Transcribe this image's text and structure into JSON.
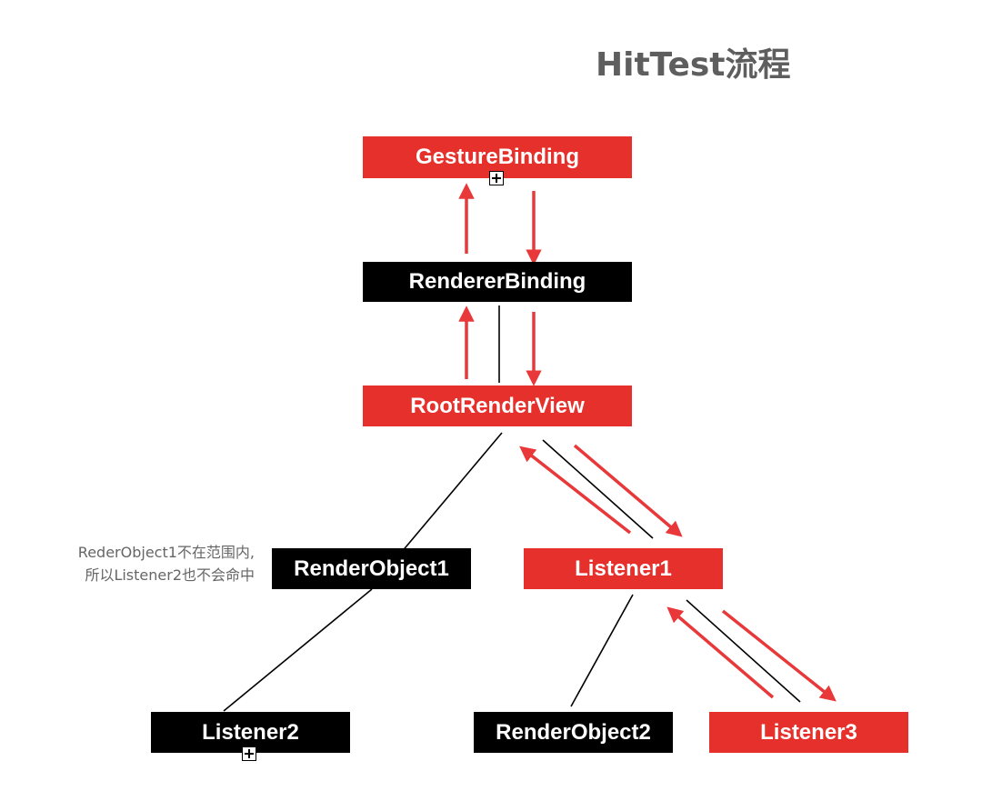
{
  "title": "HitTest流程",
  "nodes": {
    "gesture_binding": "GestureBinding",
    "renderer_binding": "RendererBinding",
    "root_render_view": "RootRenderView",
    "render_object1": "RenderObject1",
    "listener1": "Listener1",
    "listener2": "Listener2",
    "render_object2": "RenderObject2",
    "listener3": "Listener3"
  },
  "note": {
    "line1": "RederObject1不在范围内,",
    "line2": "所以Listener2也不会命中"
  },
  "icons": {
    "expand": "plus-square-icon"
  },
  "colors": {
    "hit": "#e5302c",
    "miss": "#000000",
    "arrow": "#e8383a",
    "title": "#5e5e5e",
    "note": "#666666"
  }
}
